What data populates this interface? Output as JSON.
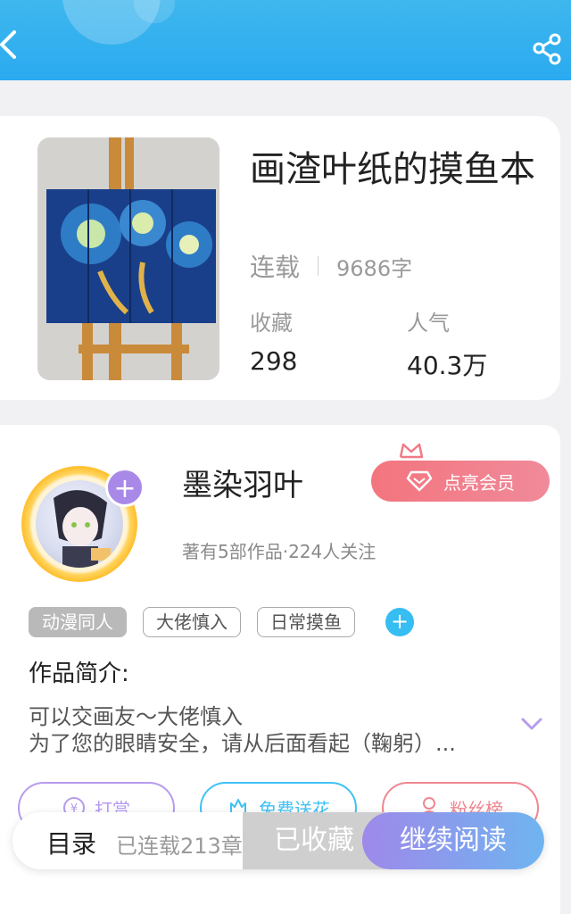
{
  "header": {
    "back_icon": "chevron-left-icon",
    "share_icon": "share-icon"
  },
  "book": {
    "title": "画渣叶纸的摸鱼本",
    "status": "连载",
    "word_count": "9686字",
    "favorites_label": "收藏",
    "favorites_value": "298",
    "popularity_label": "人气",
    "popularity_value": "40.3万"
  },
  "author": {
    "name": "墨染羽叶",
    "plus_label": "+",
    "member_button": "点亮会员",
    "meta": "著有5部作品·224人关注"
  },
  "tags": [
    "动漫同人",
    "大佬慎入",
    "日常摸鱼"
  ],
  "tag_add": "+",
  "intro": {
    "title": "作品简介:",
    "line1": "可以交画友～大佬慎入",
    "line2": "为了您的眼睛安全，请从后面看起（鞠躬）..."
  },
  "actions": {
    "reward": "打赏",
    "flower": "免费送花",
    "fans": "粉丝榜"
  },
  "bottom": {
    "toc": "目录",
    "chapter_count": "已连载213章",
    "collected": "已收藏",
    "continue": "继续阅读"
  },
  "colors": {
    "header_blue": "#2aaaf0",
    "member_pink": "#f3757e",
    "reward_purple": "#b79bee",
    "flower_blue": "#41c2f4",
    "fans_pink": "#f08790",
    "read_gradient_start": "#9e89ea",
    "read_gradient_end": "#6fb4f0"
  }
}
